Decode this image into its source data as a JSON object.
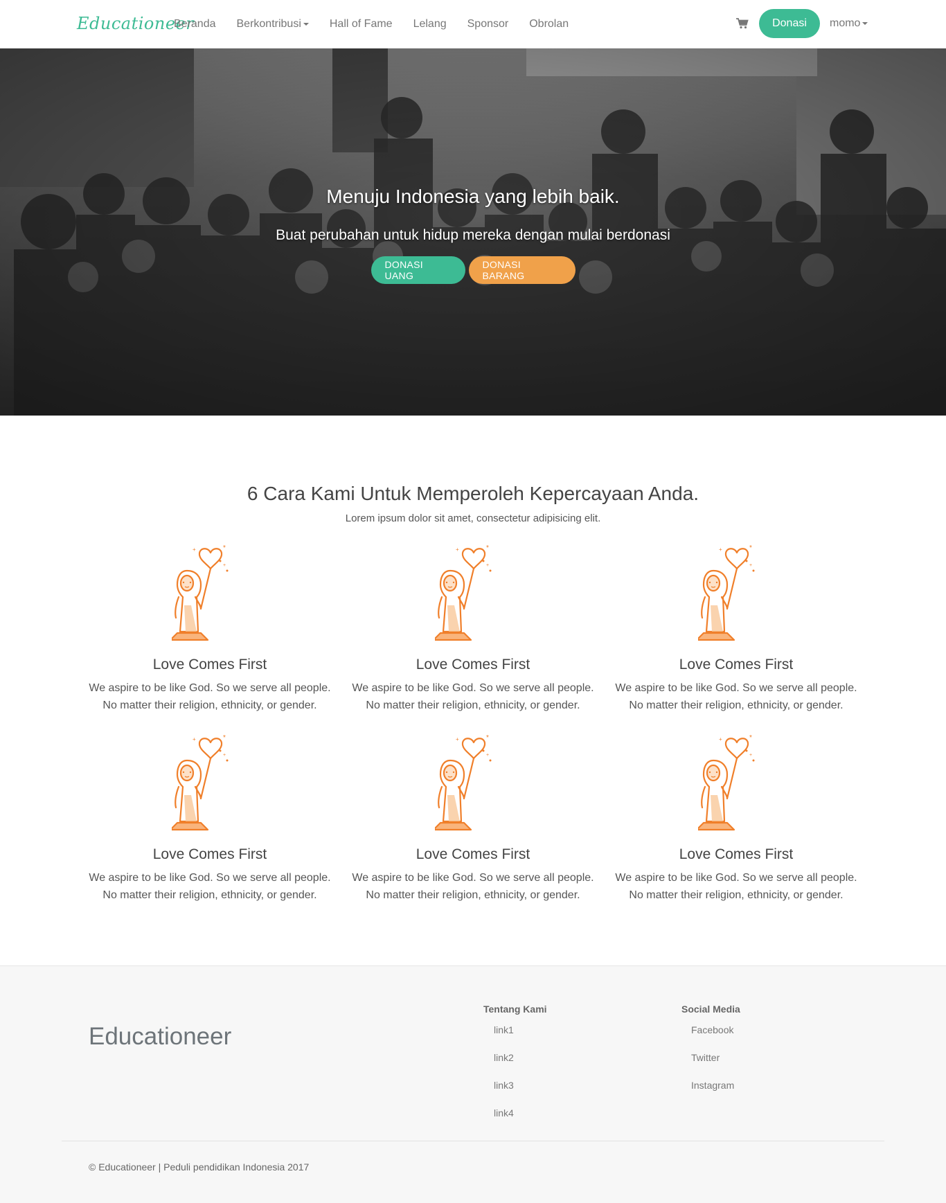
{
  "nav": {
    "brand": "Educationeer",
    "links": [
      {
        "label": "Beranda"
      },
      {
        "label": "Berkontribusi",
        "dropdown": true
      },
      {
        "label": "Hall of Fame"
      },
      {
        "label": "Lelang"
      },
      {
        "label": "Sponsor"
      },
      {
        "label": "Obrolan"
      }
    ],
    "cart_icon": "shopping-cart-icon",
    "donate_label": "Donasi",
    "user_label": "momo"
  },
  "hero": {
    "title": "Menuju Indonesia yang lebih baik.",
    "subtitle": "Buat perubahan untuk hidup mereka dengan mulai berdonasi",
    "btn_money": "DONASI UANG",
    "btn_goods": "DONASI BARANG"
  },
  "features": {
    "title": "6 Cara Kami Untuk Memperoleh Kepercayaan Anda.",
    "subtitle": "Lorem ipsum dolor sit amet, consectetur adipisicing elit.",
    "items": [
      {
        "title": "Love Comes First",
        "line1": "We aspire to be like God. So we serve all people.",
        "line2": "No matter their religion, ethnicity, or gender."
      },
      {
        "title": "Love Comes First",
        "line1": "We aspire to be like God. So we serve all people.",
        "line2": "No matter their religion, ethnicity, or gender."
      },
      {
        "title": "Love Comes First",
        "line1": "We aspire to be like God. So we serve all people.",
        "line2": "No matter their religion, ethnicity, or gender."
      },
      {
        "title": "Love Comes First",
        "line1": "We aspire to be like God. So we serve all people.",
        "line2": "No matter their religion, ethnicity, or gender."
      },
      {
        "title": "Love Comes First",
        "line1": "We aspire to be like God. So we serve all people.",
        "line2": "No matter their religion, ethnicity, or gender."
      },
      {
        "title": "Love Comes First",
        "line1": "We aspire to be like God. So we serve all people.",
        "line2": "No matter their religion, ethnicity, or gender."
      }
    ]
  },
  "footer": {
    "brand": "Educationeer",
    "about_title": "Tentang Kami",
    "about_links": [
      "link1",
      "link2",
      "link3",
      "link4"
    ],
    "social_title": "Social Media",
    "social_links": [
      "Facebook",
      "Twitter",
      "Instagram"
    ],
    "copyright": "© Educationeer | Peduli pendidikan Indonesia 2017"
  },
  "colors": {
    "accent_green": "#3dbb94",
    "accent_orange": "#f0a14a",
    "illustration_orange": "#f07f2a"
  }
}
